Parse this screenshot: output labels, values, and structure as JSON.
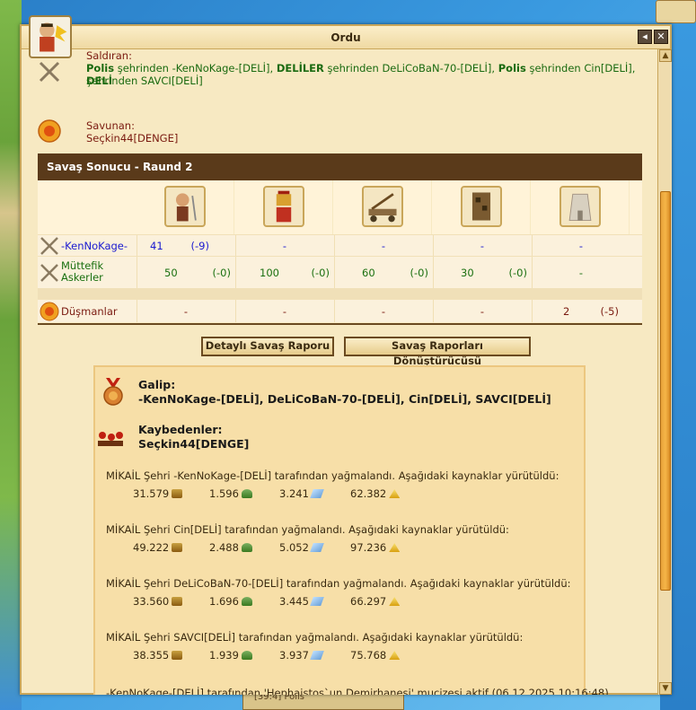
{
  "window": {
    "title": "Ordu"
  },
  "attacker": {
    "label": "Saldıran:",
    "line1": "Polis şehrinden -KenNoKage-[DELİ], DELİLER şehrinden DeLiCoBaN-70-[DELİ], Polis şehrinden Cin[DELİ], DELİ",
    "line2": "şehrinden SAVCI[DELİ]"
  },
  "defender": {
    "label": "Savunan:",
    "name": "Seçkin44[DENGE]"
  },
  "battle": {
    "header": "Savaş Sonucu - Raund 2",
    "units": [
      "hoplite-icon",
      "spartan-warrior-icon",
      "catapult-icon",
      "siege-tower-icon",
      "city-wall-icon"
    ],
    "rows": [
      {
        "label": "-KenNoKage-",
        "color": "blue",
        "cells": [
          {
            "n": "41",
            "d": "(-9)"
          },
          {
            "dash": "-"
          },
          {
            "dash": "-"
          },
          {
            "dash": "-"
          },
          {
            "dash": "-"
          }
        ]
      },
      {
        "label": "Müttefik Askerler",
        "color": "green",
        "cells": [
          {
            "n": "50",
            "d": "(-0)"
          },
          {
            "n": "100",
            "d": "(-0)"
          },
          {
            "n": "60",
            "d": "(-0)"
          },
          {
            "n": "30",
            "d": "(-0)"
          },
          {
            "dash": "-"
          }
        ]
      },
      {
        "label": "Düşmanlar",
        "color": "dred",
        "cells": [
          {
            "dash": "-"
          },
          {
            "dash": "-"
          },
          {
            "dash": "-"
          },
          {
            "dash": "-"
          },
          {
            "n": "2",
            "d": "(-5)"
          }
        ]
      }
    ]
  },
  "buttons": {
    "detail": "Detaylı Savaş Raporu",
    "convert": "Savaş Raporları Dönüştürücüsü"
  },
  "result": {
    "winner_label": "Galip:",
    "winners": "-KenNoKage-[DELİ], DeLiCoBaN-70-[DELİ], Cin[DELİ], SAVCI[DELİ]",
    "loser_label": "Kaybedenler:",
    "losers": "Seçkin44[DENGE]",
    "loot": [
      {
        "text": "MİKAİL Şehri -KenNoKage-[DELİ] tarafından yağmalandı. Aşağıdaki kaynaklar yürütüldü:",
        "wood": "31.579",
        "stone": "1.596",
        "silver": "3.241",
        "favor": "62.382"
      },
      {
        "text": "MİKAİL Şehri Cin[DELİ] tarafından yağmalandı. Aşağıdaki kaynaklar yürütüldü:",
        "wood": "49.222",
        "stone": "2.488",
        "silver": "5.052",
        "favor": "97.236"
      },
      {
        "text": "MİKAİL Şehri DeLiCoBaN-70-[DELİ] tarafından yağmalandı. Aşağıdaki kaynaklar yürütüldü:",
        "wood": "33.560",
        "stone": "1.696",
        "silver": "3.445",
        "favor": "66.297"
      },
      {
        "text": "MİKAİL Şehri SAVCI[DELİ] tarafından yağmalandı. Aşağıdaki kaynaklar yürütüldü:",
        "wood": "38.355",
        "stone": "1.939",
        "silver": "3.937",
        "favor": "75.768"
      }
    ],
    "miracle": "-KenNoKage-[DELİ] tarafından 'Hephaistos`un Demirhanesi' mucizesi aktif (06.12.2025 10:16:48)"
  },
  "background": {
    "bottom_label": "[39:4] Polis"
  }
}
